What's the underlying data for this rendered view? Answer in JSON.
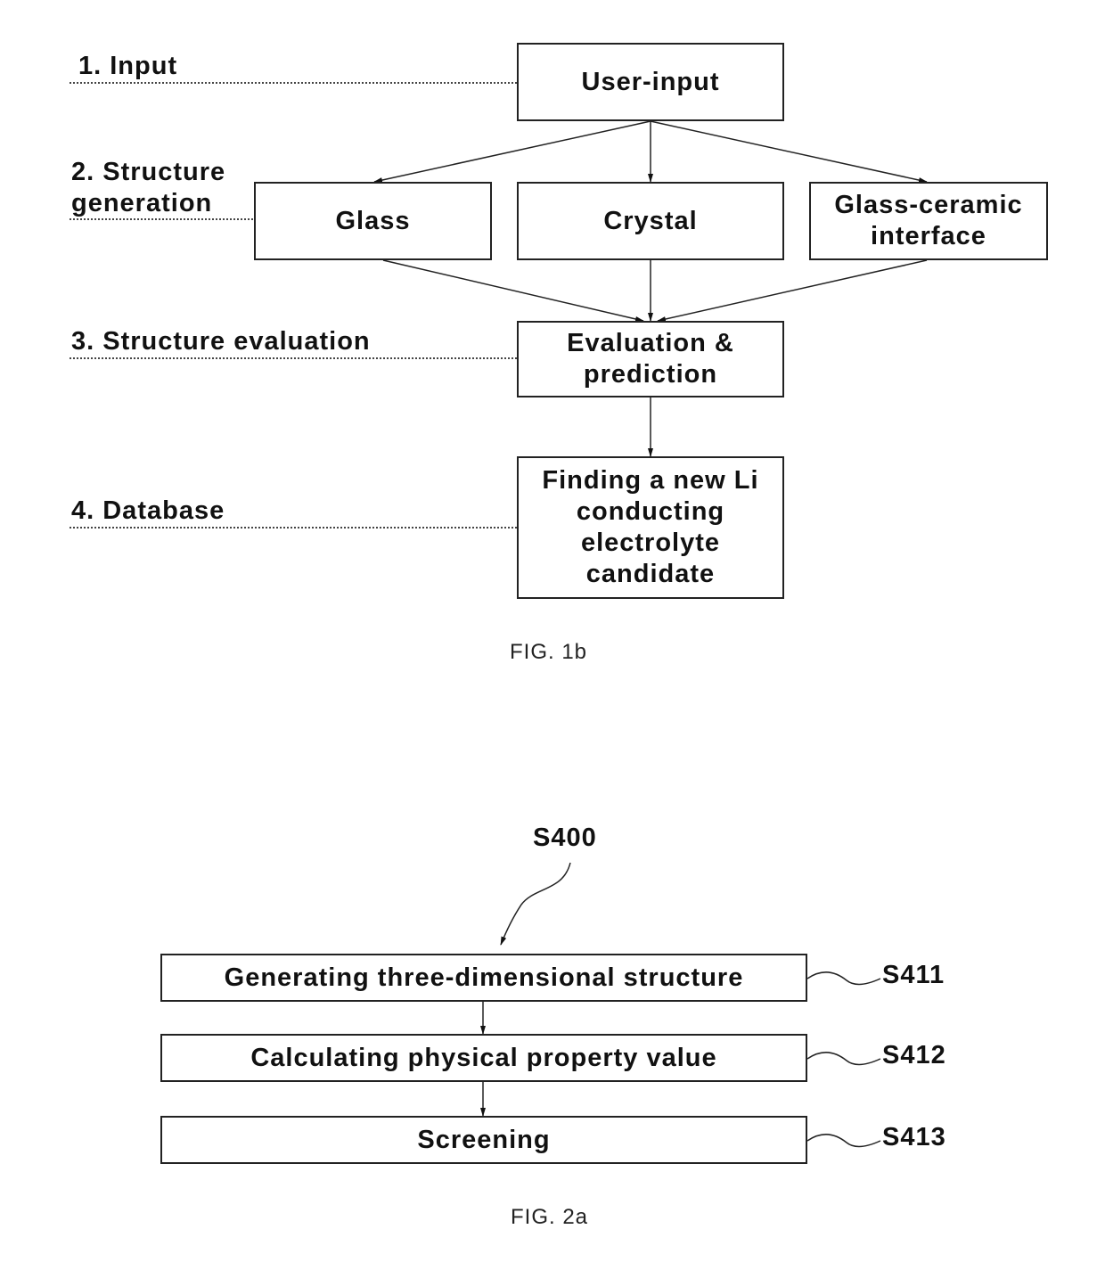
{
  "fig1b": {
    "caption": "FIG. 1b",
    "stage_labels": {
      "input": "1. Input",
      "structure_generation": "2. Structure\ngeneration",
      "structure_evaluation": "3. Structure evaluation",
      "database": "4. Database"
    },
    "boxes": {
      "user_input": "User-input",
      "glass": "Glass",
      "crystal": "Crystal",
      "glass_ceramic": "Glass-ceramic\ninterface",
      "evaluation": "Evaluation &\nprediction",
      "finding": "Finding a new Li\nconducting\nelectrolyte\ncandidate"
    }
  },
  "fig2a": {
    "caption": "FIG. 2a",
    "process_ref": "S400",
    "steps": [
      {
        "label": "Generating three-dimensional structure",
        "ref": "S411"
      },
      {
        "label": "Calculating physical property value",
        "ref": "S412"
      },
      {
        "label": "Screening",
        "ref": "S413"
      }
    ]
  }
}
